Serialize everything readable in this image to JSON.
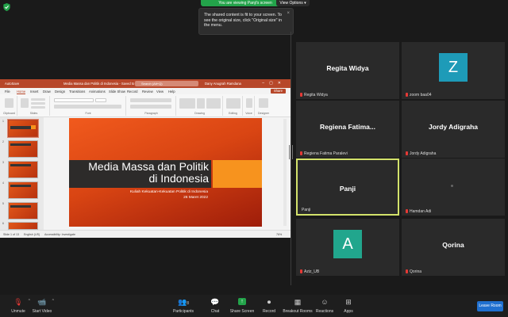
{
  "banner": {
    "text": "You are viewing Panji's screen",
    "view_options": "View Options ▾"
  },
  "tooltip": {
    "text": "The shared content is fit to your screen. To see the original size, click \"Original size\" in the menu.",
    "close": "×"
  },
  "ppt": {
    "autosave": "AutoSave",
    "doc_title": "Media Massa dan Politik di Indonesia - Saved to this PC",
    "search": "Search (Alt+Q)",
    "user": "Dany Anugrah Ramdana",
    "tabs": [
      "File",
      "Home",
      "Insert",
      "Draw",
      "Design",
      "Transitions",
      "Animations",
      "Slide Show",
      "Record",
      "Review",
      "View",
      "Help"
    ],
    "share": "Share",
    "groups": [
      "Clipboard",
      "Slides",
      "Font",
      "Paragraph",
      "Drawing",
      "Editing",
      "Voice",
      "Designer"
    ],
    "slide_title": "Media Massa dan Politik di Indonesia",
    "slide_sub1": "Kuliah Kekuatan-Kekuatan Politik di Indonesia",
    "slide_sub2": "26 Maret 2022",
    "status": {
      "slide": "Slide 1 of 13",
      "lang": "English (US)",
      "access": "Accessibility: Investigate",
      "zoom": "76%"
    },
    "thumb_nums": [
      "1",
      "2",
      "3",
      "4",
      "5",
      "6",
      "7"
    ]
  },
  "participants": [
    {
      "name": "Regita Widya",
      "label": "Regita Widya"
    },
    {
      "avatar": "Z",
      "label": "zoom baa04"
    },
    {
      "name": "Regiena  Fatima...",
      "label": "Regiena Fatima Paralevi"
    },
    {
      "name": "Jordy Adigraha",
      "label": "Jordy Adigraha"
    },
    {
      "name": "Panji",
      "label": "Panji"
    },
    {
      "label": "Hamdan Adi"
    },
    {
      "avatar": "A",
      "label": "Aziz_UB"
    },
    {
      "name": "Qorina",
      "label": "Qorina"
    }
  ],
  "toolbar": {
    "unmute": "Unmute",
    "start_video": "Start Video",
    "participants": "Participants",
    "participants_count": "8",
    "chat": "Chat",
    "share_screen": "Share Screen",
    "record": "Record",
    "breakout": "Breakout Rooms",
    "reactions": "Reactions",
    "apps": "Apps",
    "leave": "Leave Room"
  }
}
